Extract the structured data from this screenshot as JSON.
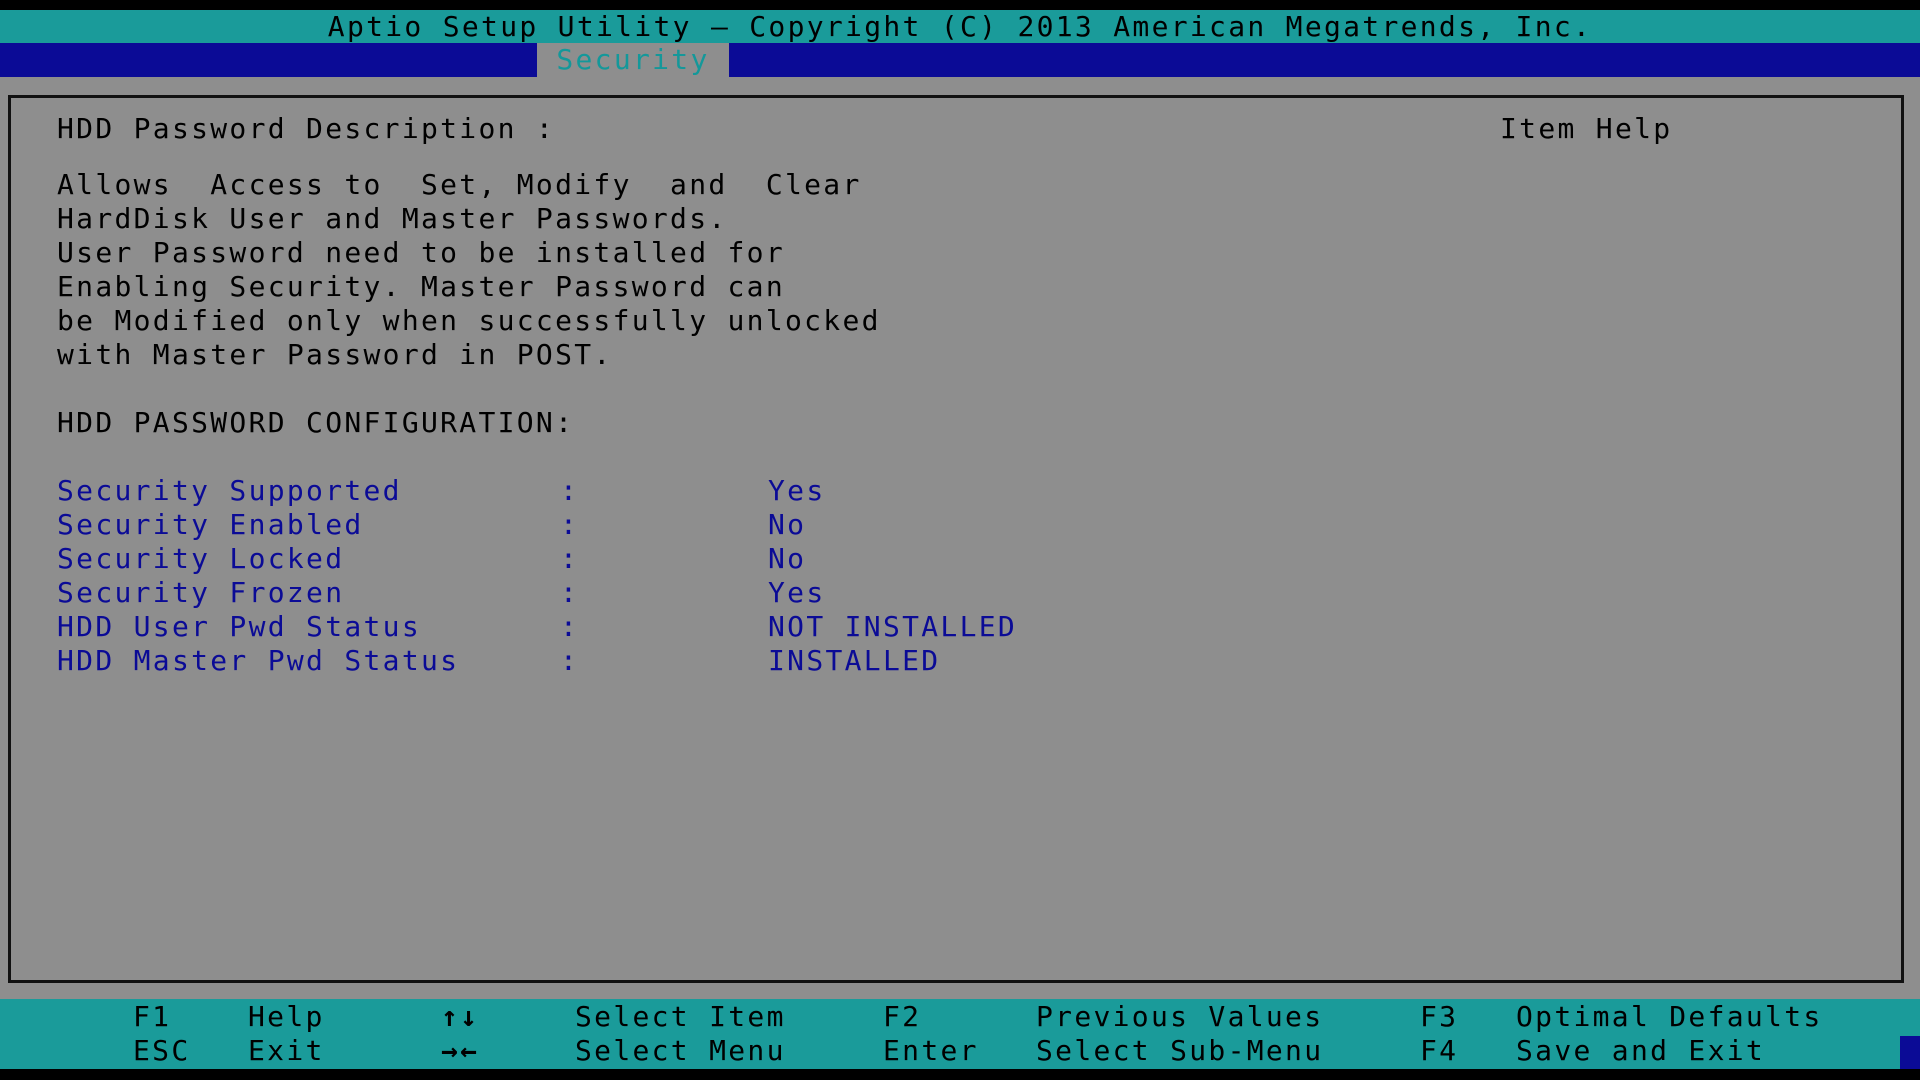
{
  "title": "Aptio Setup Utility – Copyright (C) 2013 American Megatrends, Inc.",
  "menu": {
    "active_tab": "Security"
  },
  "main": {
    "description_heading": "HDD Password Description :",
    "item_help": "Item Help",
    "description_lines": [
      "Allows  Access to  Set, Modify  and  Clear",
      "HardDisk User and Master Passwords.",
      "User Password need to be installed for",
      "Enabling Security. Master Password can",
      "be Modified only when successfully unlocked",
      "with Master Password in POST."
    ],
    "config_heading": "HDD PASSWORD CONFIGURATION:",
    "separator": ":",
    "fields": [
      {
        "label": "Security Supported",
        "value": "Yes"
      },
      {
        "label": "Security Enabled",
        "value": "No"
      },
      {
        "label": "Security Locked",
        "value": "No"
      },
      {
        "label": "Security Frozen",
        "value": "Yes"
      },
      {
        "label": "HDD User Pwd Status",
        "value": "NOT INSTALLED"
      },
      {
        "label": "HDD Master Pwd Status",
        "value": "INSTALLED"
      }
    ]
  },
  "footer": {
    "keys": [
      {
        "key": "F1",
        "action": "Help"
      },
      {
        "key": "ESC",
        "action": "Exit"
      },
      {
        "key": "↑↓",
        "action": "Select Item"
      },
      {
        "key": "→←",
        "action": "Select Menu"
      },
      {
        "key": "F2",
        "action": "Previous Values"
      },
      {
        "key": "Enter",
        "action": "Select Sub-Menu"
      },
      {
        "key": "F3",
        "action": "Optimal Defaults"
      },
      {
        "key": "F4",
        "action": "Save and Exit"
      }
    ]
  },
  "colors": {
    "teal_bar": "#1a9b9a",
    "menu_blue": "#0b0b96",
    "panel_gray": "#8e8e8e",
    "field_blue": "#0b0b96"
  }
}
